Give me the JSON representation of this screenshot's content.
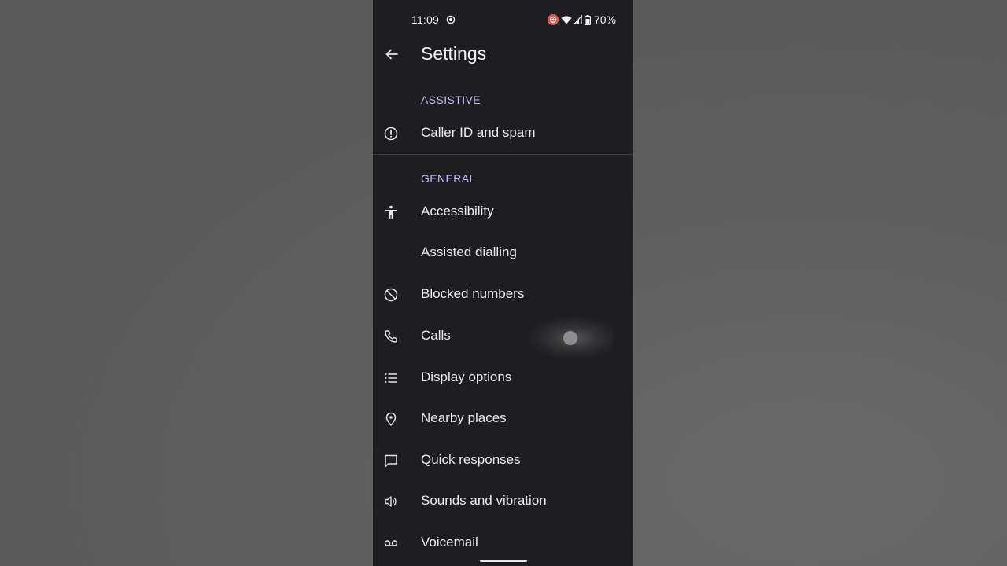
{
  "status_bar": {
    "time": "11:09",
    "battery": "70%"
  },
  "app_bar": {
    "title": "Settings"
  },
  "sections": {
    "assistive": "ASSISTIVE",
    "general": "GENERAL"
  },
  "items": {
    "caller_id": {
      "label": "Caller ID and spam",
      "icon": "info-icon"
    },
    "accessibility": {
      "label": "Accessibility",
      "icon": "accessibility-icon"
    },
    "assisted_dialling": {
      "label": "Assisted dialling"
    },
    "blocked_numbers": {
      "label": "Blocked numbers",
      "icon": "block-icon"
    },
    "calls": {
      "label": "Calls",
      "icon": "phone-icon"
    },
    "display_options": {
      "label": "Display options",
      "icon": "list-icon"
    },
    "nearby_places": {
      "label": "Nearby places",
      "icon": "location-pin-icon"
    },
    "quick_responses": {
      "label": "Quick responses",
      "icon": "message-icon"
    },
    "sounds_vibration": {
      "label": "Sounds and vibration",
      "icon": "speaker-icon"
    },
    "voicemail": {
      "label": "Voicemail",
      "icon": "voicemail-icon"
    }
  },
  "colors": {
    "background": "#1e1e22",
    "section_accent": "#c9b8f5",
    "text": "#ebe7ec",
    "record_indicator": "#e05a4f"
  }
}
